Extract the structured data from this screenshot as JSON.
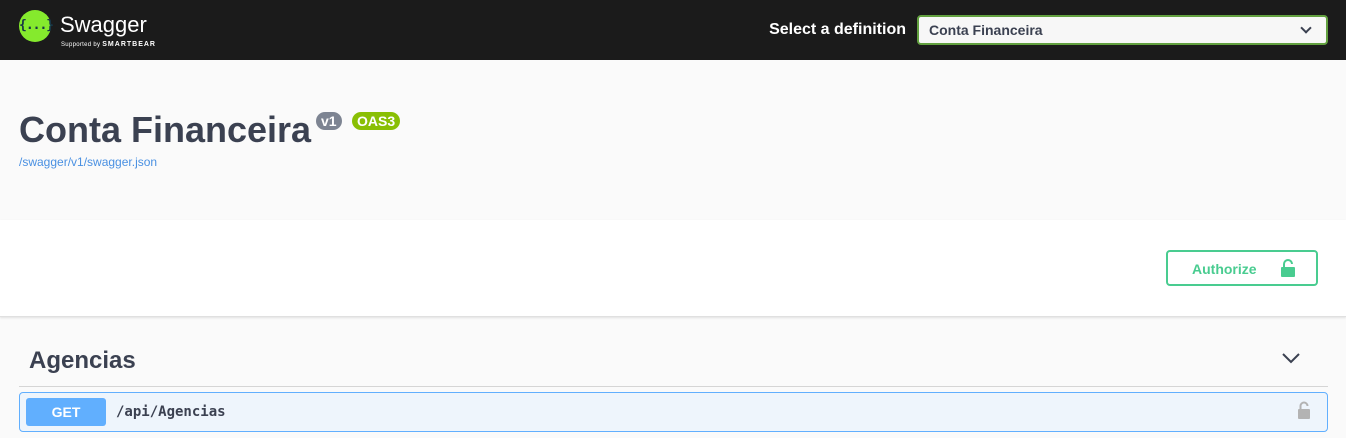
{
  "topbar": {
    "logo_glyph": "{...}",
    "brand_name": "Swagger",
    "brand_tagline_prefix": "Supported by",
    "brand_tagline_company": "SMARTBEAR",
    "select_label": "Select a definition",
    "selected_definition": "Conta Financeira"
  },
  "info": {
    "title": "Conta Financeira",
    "version_badge": "v1",
    "spec_badge": "OAS3",
    "spec_url": "/swagger/v1/swagger.json"
  },
  "authorize": {
    "label": "Authorize"
  },
  "tags": [
    {
      "name": "Agencias",
      "operations": [
        {
          "method": "GET",
          "path": "/api/Agencias"
        }
      ]
    }
  ],
  "colors": {
    "topbar": "#1b1b1b",
    "logo": "#85ea2d",
    "select_border": "#62a03f",
    "authorize": "#49cc90",
    "get_method": "#61affe",
    "version_badge": "#7d8492",
    "spec_badge": "#89bf04",
    "link": "#4990e2"
  }
}
